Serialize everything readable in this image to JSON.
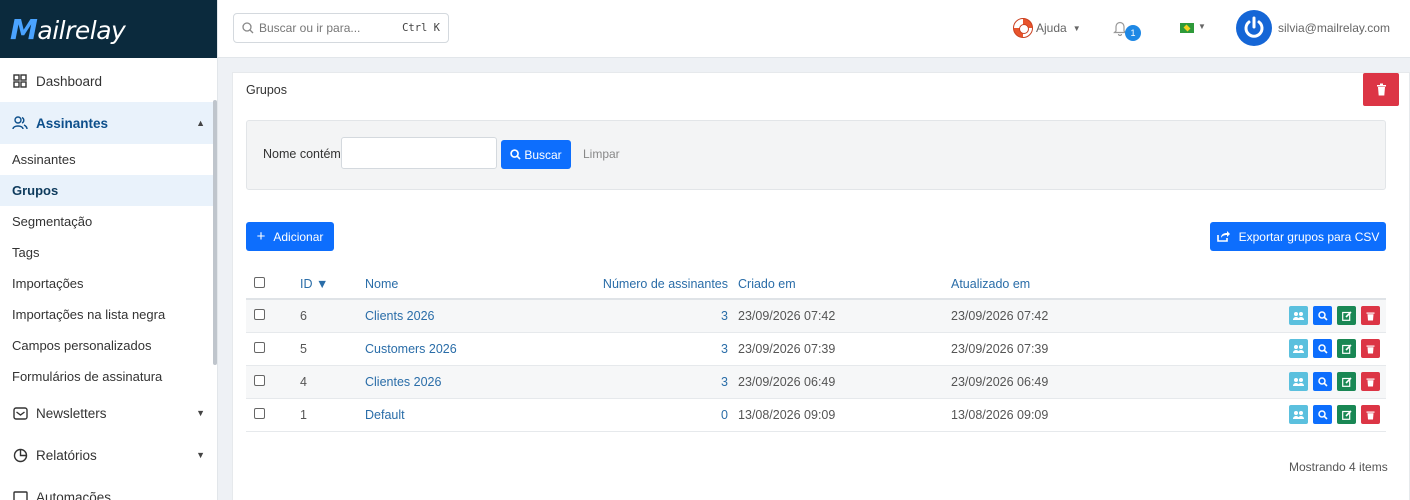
{
  "brand": {
    "logo_mark": "M",
    "logo_rest": "ailrelay"
  },
  "sidebar": {
    "items": [
      {
        "label": "Dashboard",
        "icon": "dashboard-icon"
      },
      {
        "label": "Assinantes",
        "icon": "users-icon",
        "active": true
      },
      {
        "label": "Newsletters",
        "icon": "mail-icon"
      },
      {
        "label": "Relatórios",
        "icon": "pie-chart-icon"
      },
      {
        "label": "Automações",
        "icon": "automation-icon"
      }
    ],
    "sub_items": [
      {
        "label": "Assinantes"
      },
      {
        "label": "Grupos",
        "active": true
      },
      {
        "label": "Segmentação"
      },
      {
        "label": "Tags"
      },
      {
        "label": "Importações"
      },
      {
        "label": "Importações na lista negra"
      },
      {
        "label": "Campos personalizados"
      },
      {
        "label": "Formulários de assinatura"
      }
    ]
  },
  "topbar": {
    "search_placeholder": "Buscar ou ir para...",
    "search_shortcut": "Ctrl K",
    "help_label": "Ajuda",
    "notification_count": "1",
    "user_email": "silvia@mailrelay.com"
  },
  "page": {
    "breadcrumb": "Grupos",
    "filter": {
      "label": "Nome contém",
      "value": "",
      "search_button": "Buscar",
      "clear_button": "Limpar"
    },
    "add_button": "Adicionar",
    "export_button": "Exportar grupos para CSV",
    "table": {
      "columns": [
        "ID ▼",
        "Nome",
        "Número de assinantes",
        "Criado em",
        "Atualizado em"
      ],
      "rows": [
        {
          "id": "6",
          "name": "Clients 2026",
          "subscribers": "3",
          "created": "23/09/2026 07:42",
          "updated": "23/09/2026 07:42"
        },
        {
          "id": "5",
          "name": "Customers 2026",
          "subscribers": "3",
          "created": "23/09/2026 07:39",
          "updated": "23/09/2026 07:39"
        },
        {
          "id": "4",
          "name": "Clientes 2026",
          "subscribers": "3",
          "created": "23/09/2026 06:49",
          "updated": "23/09/2026 06:49"
        },
        {
          "id": "1",
          "name": "Default",
          "subscribers": "0",
          "created": "13/08/2026 09:09",
          "updated": "13/08/2026 09:09"
        }
      ]
    },
    "showing": "Mostrando 4 items"
  },
  "colors": {
    "primary": "#0d6efd",
    "danger": "#dc3545",
    "success": "#198754",
    "info": "#5bc0de",
    "sidebar_header": "#0b2a3d"
  }
}
